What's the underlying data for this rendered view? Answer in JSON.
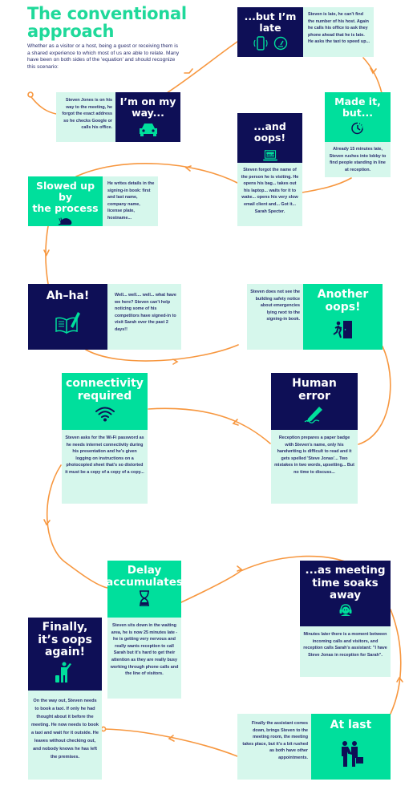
{
  "header": {
    "title": "The conventional approach",
    "intro": "Whether as a visitor or a host, being a guest or receiving them is a shared experience to which most of us are able to relate. Many have been on both sides of the 'equation' and should recognize this scenario:"
  },
  "colors": {
    "navy": "#0e0f56",
    "green": "#00df9c",
    "mint": "#d6f7ec",
    "path": "#f7973f",
    "title": "#1fd99a",
    "text": "#2a2f6e"
  },
  "steps": [
    {
      "heading": "I’m on my\nway...",
      "icon": "car-icon",
      "text": "Steven Jones is on his way to the meeting, he forgot the exact address so he checks Google or calls his office."
    },
    {
      "heading": "...but I’m\nlate",
      "icon": "phone-vibrate-icon, speedometer-icon",
      "text": "Steven is late, he can't find the number of his host. Again he calls his office to ask they phone ahead that he is late. He asks the taxi to speed up..."
    },
    {
      "heading": "Made it,\nbut...",
      "icon": "clock-icon",
      "text": "Already 15 minutes late, Steven rushes into lobby to find people standing in line at reception."
    },
    {
      "heading": "...and oops!",
      "icon": "laptop-help-icon",
      "text": "Steven forgot the name of the person he is visiting. He opens his bag... takes out his laptop... waits for it to wake... opens his very slow email client and... Got it... Sarah Specter."
    },
    {
      "heading": "Slowed up by\nthe process",
      "icon": "snail-icon",
      "text": "He writes details in the signing-in book: first and last name, company name, license plate, hostname..."
    },
    {
      "heading": "Ah–ha!",
      "icon": "book-pencil-icon",
      "text": "Well... well.... well... what have we here? Steven can't help noticing some of his competitors have signed-in to visit Sarah over the past 2 days!!"
    },
    {
      "heading": "Another\noops!",
      "icon": "emergency-exit-icon",
      "text": "Steven does not see the building safety notice about emergencies lying next to the signing-in book."
    },
    {
      "heading": "Human\nerror",
      "icon": "pen-signature-icon",
      "text": "Reception prepares a paper badge with Steven's name, only his handwriting is difficult to read and it gets spelled 'Steve Jonas'... Two mistakes in two words, upsetting... But no time to discuss..."
    },
    {
      "heading": "connectivity\nrequired",
      "icon": "wifi-icon",
      "text": "Steven asks for the Wi-Fi password as he needs internet connectivity during his presentation and he's given logging on instructions on a photocopied sheet that's so distorted it must be a copy of a copy of a copy..."
    },
    {
      "heading": "Delay\naccumulates",
      "icon": "hourglass-icon",
      "text": "Steven sits down in the waiting area, he is now 25 minutes late - he is getting very nervous and really wants reception to call Sarah but it's hard to get their attention as they are really busy working through phone calls and the line of visitors."
    },
    {
      "heading": "...as meeting\ntime soaks\naway",
      "icon": "receptionist-headset-icon",
      "text": "Minutes later there is a moment between incoming calls and visitors, and reception calls Sarah's assistant: \"I have Steve Jonas in reception for Sarah\"."
    },
    {
      "heading": "At last",
      "icon": "handshake-icon",
      "text": "Finally the assistant comes down, brings Steven to the meeting room, the meeting takes place, but it's a bit rushed as both have other appointments."
    },
    {
      "heading": "Finally,\nit’s oops\nagain!",
      "icon": "hail-taxi-icon",
      "text": "On the way out, Steven needs to book a taxi. If only he had thought about it before the meeting. He now needs to book a taxi and wait for it outside. He leaves without checking out, and nobody knows he has left the premises."
    }
  ]
}
